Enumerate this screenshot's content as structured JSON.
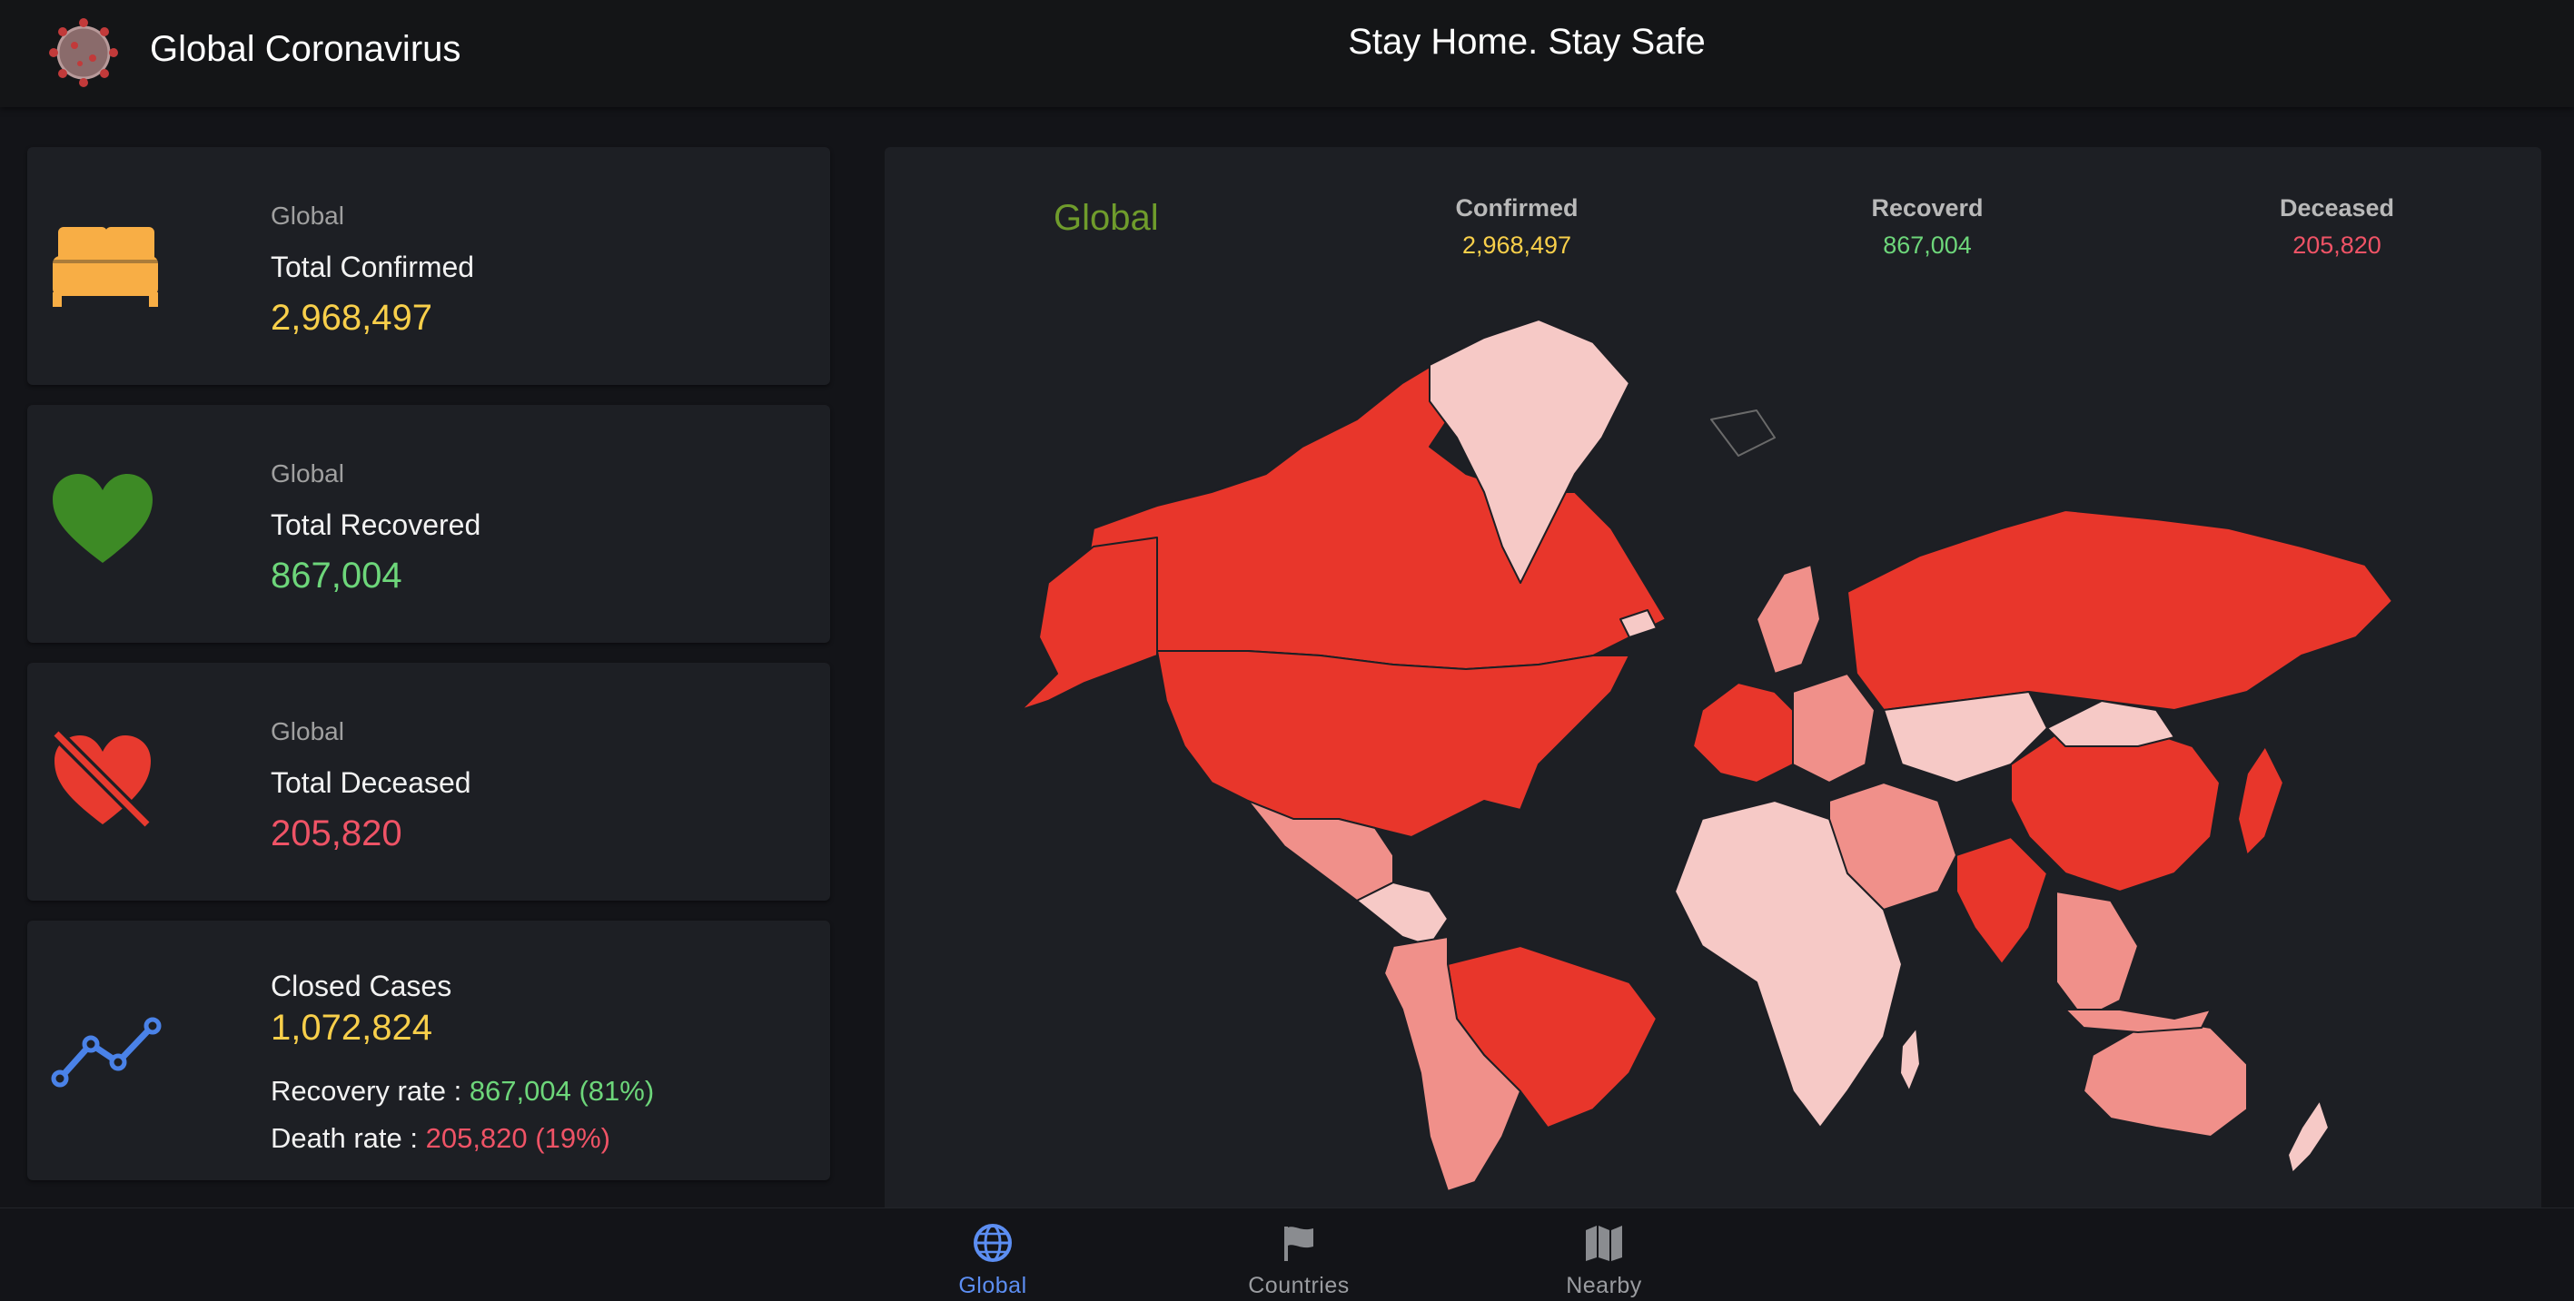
{
  "app": {
    "title": "Global Coronavirus",
    "tagline": "Stay Home. Stay Safe"
  },
  "cards": {
    "confirmed": {
      "scope": "Global",
      "label": "Total Confirmed",
      "value": "2,968,497",
      "icon": "bed-icon"
    },
    "recovered": {
      "scope": "Global",
      "label": "Total Recovered",
      "value": "867,004",
      "icon": "heart-icon"
    },
    "deceased": {
      "scope": "Global",
      "label": "Total Deceased",
      "value": "205,820",
      "icon": "heart-broken-icon"
    },
    "closed": {
      "label": "Closed Cases",
      "value": "1,072,824",
      "recovery_label": "Recovery rate : ",
      "recovery_value": "867,004 (81%)",
      "death_label": "Death rate : ",
      "death_value": "205,820 (19%)",
      "icon": "trend-line-icon"
    }
  },
  "map": {
    "title": "Global",
    "confirmed_label": "Confirmed",
    "confirmed_value": "2,968,497",
    "recovered_label": "Recoverd",
    "recovered_value": "867,004",
    "deceased_label": "Deceased",
    "deceased_value": "205,820"
  },
  "nav": {
    "global": "Global",
    "countries": "Countries",
    "nearby": "Nearby"
  },
  "colors": {
    "confirmed": "#f8cf4a",
    "recovered": "#6dd67a",
    "deceased": "#ef5366",
    "map_high": "#e8362b",
    "map_mid": "#f0908a",
    "map_low": "#f6c9c6",
    "nav_active": "#5c8ef2"
  }
}
